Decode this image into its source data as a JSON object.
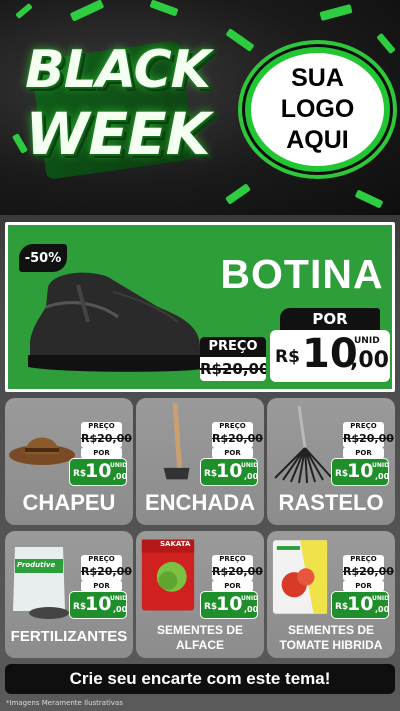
{
  "header": {
    "title_line1": "BLACK",
    "title_line2": "WEEK",
    "logo_line1": "SUA",
    "logo_line2": "LOGO",
    "logo_line3": "AQUI"
  },
  "hero": {
    "discount": "-50%",
    "name": "BOTINA",
    "por_label": "POR",
    "preco_label": "PREÇO",
    "old_price": "R$20,00",
    "currency": "R$",
    "price_int": "10",
    "price_cents": ",00",
    "unit": "UNID",
    "icon": "boot-icon"
  },
  "products": [
    {
      "name": "CHAPEU",
      "preco_label": "PREÇO",
      "old": "R$20,00",
      "por_label": "POR",
      "currency": "R$",
      "price": "10",
      "cents": ",00",
      "unit": "UNID",
      "icon": "hat-icon"
    },
    {
      "name": "ENCHADA",
      "preco_label": "PREÇO",
      "old": "R$20,00",
      "por_label": "POR",
      "currency": "R$",
      "price": "10",
      "cents": ",00",
      "unit": "UNID",
      "icon": "hoe-icon"
    },
    {
      "name": "RASTELO",
      "preco_label": "PREÇO",
      "old": "R$20,00",
      "por_label": "POR",
      "currency": "R$",
      "price": "10",
      "cents": ",00",
      "unit": "UNID",
      "icon": "rake-icon"
    },
    {
      "name": "FERTILIZANTES",
      "preco_label": "PREÇO",
      "old": "R$20,00",
      "por_label": "POR",
      "currency": "R$",
      "price": "10",
      "cents": ",00",
      "unit": "UNID",
      "icon": "fertilizer-bag-icon",
      "pack_text": "Produtive"
    },
    {
      "name_line1": "SEMENTES DE",
      "name_line2": "ALFACE",
      "preco_label": "PREÇO",
      "old": "R$20,00",
      "por_label": "POR",
      "currency": "R$",
      "price": "10",
      "cents": ",00",
      "unit": "UNID",
      "icon": "seed-pack-icon",
      "pack_text": "SAKATA"
    },
    {
      "name_line1": "SEMENTES DE",
      "name_line2": "TOMATE HIBRIDA",
      "preco_label": "PREÇO",
      "old": "R$20,00",
      "por_label": "POR",
      "currency": "R$",
      "price": "10",
      "cents": ",00",
      "unit": "UNID",
      "icon": "seed-pack-icon"
    }
  ],
  "cta": "Crie seu encarte com este tema!",
  "disclaimer": "*Imagens Meramente Ilustrativas",
  "colors": {
    "brand_green": "#2e9e3a",
    "dark": "#111111",
    "card_gray": "#8c8c8c"
  }
}
